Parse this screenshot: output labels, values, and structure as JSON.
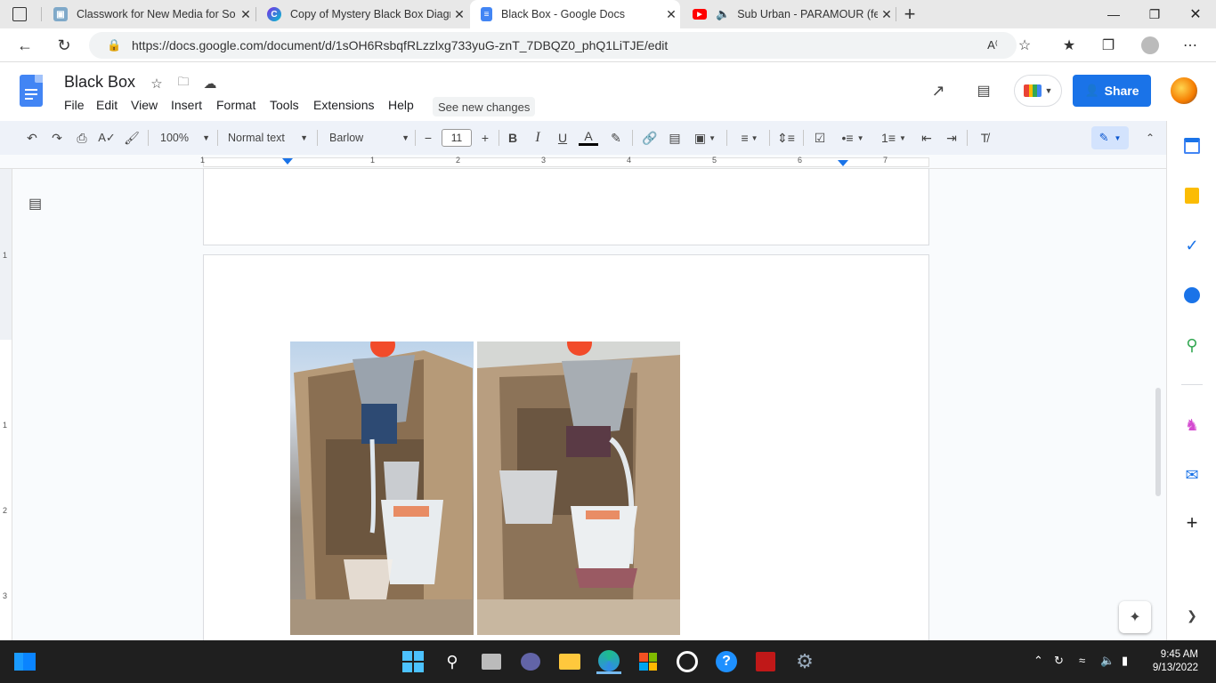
{
  "browser": {
    "tabs": [
      {
        "title": "Classwork for New Media for So",
        "icon": "classroom-icon",
        "active": false
      },
      {
        "title": "Copy of Mystery Black Box Diagr",
        "icon": "canva-icon",
        "active": false
      },
      {
        "title": "Black Box - Google Docs",
        "icon": "docs-icon",
        "active": true
      },
      {
        "title": "Sub Urban - PARAMOUR (fe",
        "icon": "youtube-icon",
        "active": false
      }
    ],
    "new_tab": "+",
    "url": "https://docs.google.com/document/d/1sOH6RsbqfRLzzlxg733yuG-znT_7DBQZ0_phQ1LiTJE/edit"
  },
  "docs": {
    "title": "Black Box",
    "menu": [
      "File",
      "Edit",
      "View",
      "Insert",
      "Format",
      "Tools",
      "Extensions",
      "Help"
    ],
    "see_new_changes": "See new changes",
    "share_label": "Share",
    "toolbar": {
      "zoom": "100%",
      "style": "Normal text",
      "font": "Barlow",
      "font_size": "11"
    },
    "ruler_numbers": [
      "1",
      "1",
      "2",
      "3",
      "4",
      "5",
      "6",
      "7"
    ],
    "vruler_numbers": [
      "1",
      "1",
      "2",
      "3"
    ]
  },
  "taskbar": {
    "time": "9:45 AM",
    "date": "9/13/2022"
  },
  "colors": {
    "docs_blue": "#4285f4",
    "share_blue": "#1a73e8",
    "toolbar_bg": "#eef2f9",
    "taskbar_bg": "#1f1f1f"
  }
}
